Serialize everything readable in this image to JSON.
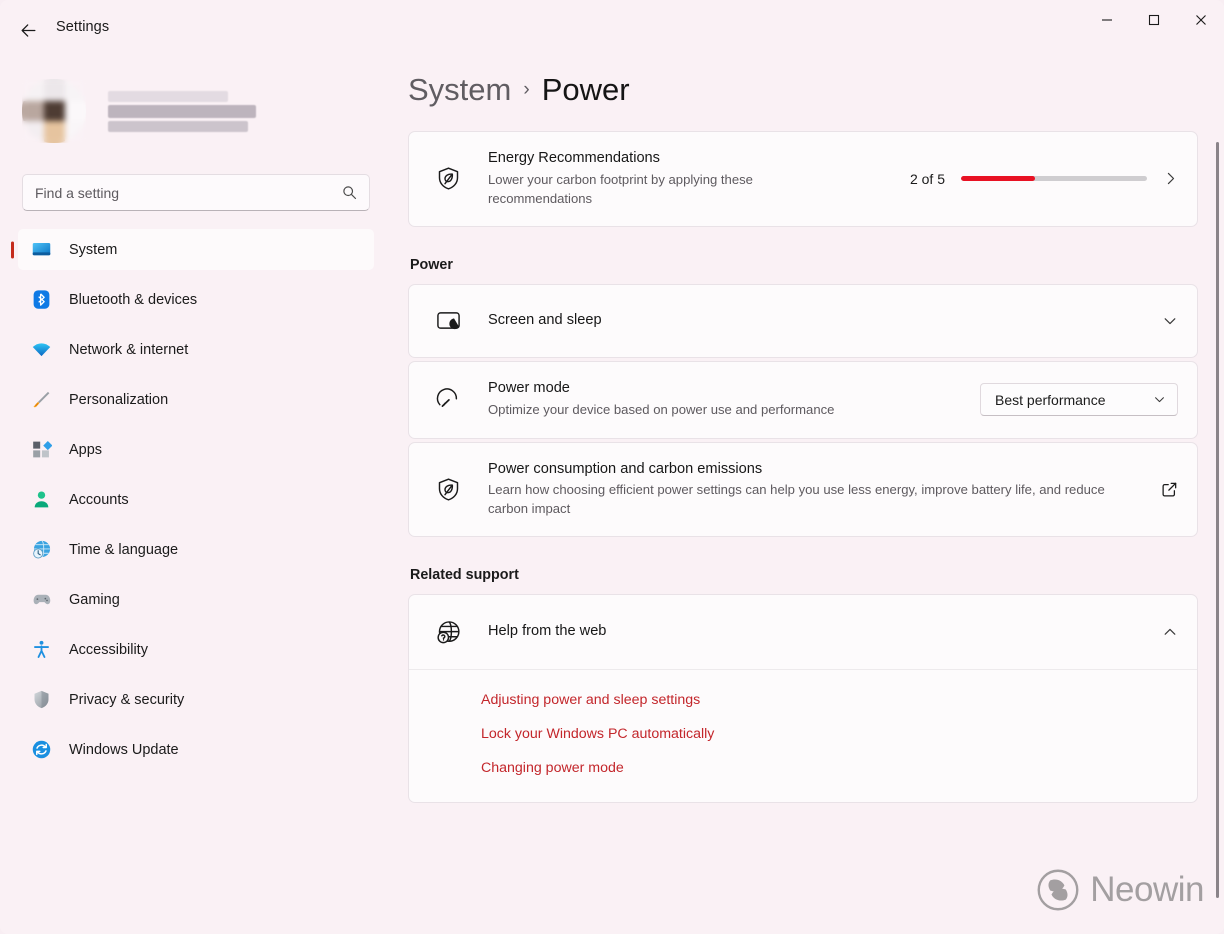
{
  "window": {
    "title": "Settings",
    "back_icon": "back-arrow-icon",
    "controls": {
      "minimize": "minimize-icon",
      "maximize": "maximize-icon",
      "close": "close-icon"
    }
  },
  "sidebar": {
    "account": {
      "avatar": "user-avatar-blurred",
      "name_redacted": true
    },
    "search": {
      "placeholder": "Find a setting",
      "value": "",
      "icon": "search-icon"
    },
    "items": [
      {
        "label": "System",
        "icon": "monitor-icon",
        "active": true
      },
      {
        "label": "Bluetooth & devices",
        "icon": "bluetooth-icon",
        "active": false
      },
      {
        "label": "Network & internet",
        "icon": "wifi-icon",
        "active": false
      },
      {
        "label": "Personalization",
        "icon": "paintbrush-icon",
        "active": false
      },
      {
        "label": "Apps",
        "icon": "apps-icon",
        "active": false
      },
      {
        "label": "Accounts",
        "icon": "person-icon",
        "active": false
      },
      {
        "label": "Time & language",
        "icon": "globe-clock-icon",
        "active": false
      },
      {
        "label": "Gaming",
        "icon": "gamepad-icon",
        "active": false
      },
      {
        "label": "Accessibility",
        "icon": "accessibility-icon",
        "active": false
      },
      {
        "label": "Privacy & security",
        "icon": "shield-icon",
        "active": false
      },
      {
        "label": "Windows Update",
        "icon": "update-sync-icon",
        "active": false
      }
    ]
  },
  "breadcrumb": {
    "parent": "System",
    "separator": "›",
    "current": "Power"
  },
  "energy_card": {
    "title": "Energy Recommendations",
    "description": "Lower your carbon footprint by applying these recommendations",
    "icon": "leaf-shield-icon",
    "count_label": "2 of 5",
    "progress_completed": 2,
    "progress_total": 5,
    "progress_percent": 40,
    "progress_color": "#e81123",
    "track_color": "#cfcdd0",
    "chevron": "chevron-right-icon"
  },
  "sections": {
    "power_header": "Power",
    "related_support_header": "Related support"
  },
  "power_rows": [
    {
      "title": "Screen and sleep",
      "description": "",
      "icon": "monitor-moon-icon",
      "control": "chevron-down-icon"
    },
    {
      "title": "Power mode",
      "description": "Optimize your device based on power use and performance",
      "icon": "gauge-icon",
      "control": "dropdown",
      "dropdown_value": "Best performance",
      "dropdown_chevron": "chevron-down-icon"
    },
    {
      "title": "Power consumption and carbon emissions",
      "description": "Learn how choosing efficient power settings can help you use less energy, improve battery life, and reduce carbon impact",
      "icon": "leaf-shield-icon",
      "control": "external-link-icon"
    }
  ],
  "help_section": {
    "title": "Help from the web",
    "icon": "globe-question-icon",
    "expanded": true,
    "chevron": "chevron-up-icon",
    "links": [
      "Adjusting power and sleep settings",
      "Lock your Windows PC automatically",
      "Changing power mode"
    ]
  },
  "watermark": {
    "text": "Neowin",
    "logo": "neowin-logo-icon"
  }
}
